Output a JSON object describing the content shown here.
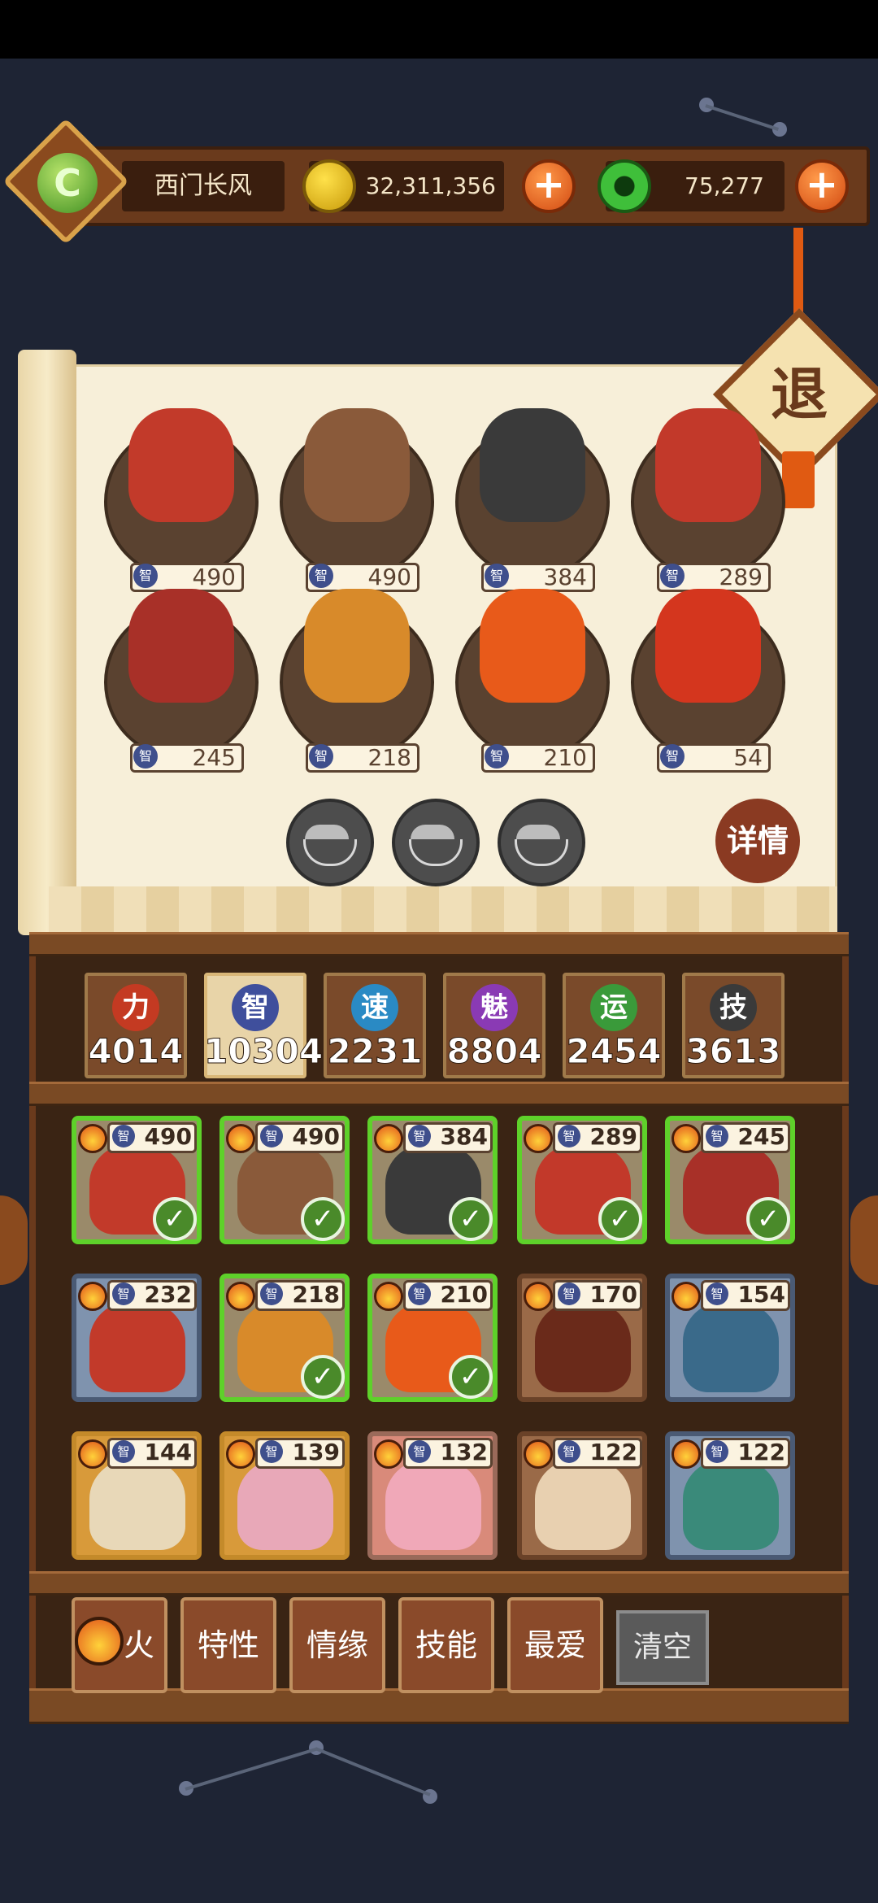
{
  "header": {
    "player_name": "西门长风",
    "logo_icon": "jade-dragon-icon",
    "logo_glyph": "C",
    "coins": "32,311,356",
    "jade": "75,277",
    "plus_label": "+",
    "colors": {
      "coin": "#e8c21a",
      "jade": "#3fbf3a",
      "plus": "#d24a12"
    }
  },
  "exit_label": "退",
  "details_label": "详情",
  "selected_heroes": [
    {
      "stat_icon": "智",
      "value": "490",
      "color": "#c23a2a"
    },
    {
      "stat_icon": "智",
      "value": "490",
      "color": "#8a5a3a"
    },
    {
      "stat_icon": "智",
      "value": "384",
      "color": "#3a3a3a"
    },
    {
      "stat_icon": "智",
      "value": "289",
      "color": "#c2392a"
    },
    {
      "stat_icon": "智",
      "value": "245",
      "color": "#a83028"
    },
    {
      "stat_icon": "智",
      "value": "218",
      "color": "#d88a2a"
    },
    {
      "stat_icon": "智",
      "value": "210",
      "color": "#e85a1a"
    },
    {
      "stat_icon": "智",
      "value": "54",
      "color": "#d4361e"
    }
  ],
  "empty_slots": 3,
  "stat_tabs": [
    {
      "icon": "力",
      "value": "4014",
      "color": "#c43a22",
      "selected": false
    },
    {
      "icon": "智",
      "value": "10304",
      "color": "#3f4f9c",
      "selected": true
    },
    {
      "icon": "速",
      "value": "2231",
      "color": "#2a8ac4",
      "selected": false
    },
    {
      "icon": "魅",
      "value": "8804",
      "color": "#8a3ab4",
      "selected": false
    },
    {
      "icon": "运",
      "value": "2454",
      "color": "#3a9a3a",
      "selected": false
    },
    {
      "icon": "技",
      "value": "3613",
      "color": "#3a3a3a",
      "selected": false
    }
  ],
  "hero_cards": [
    {
      "value": "490",
      "style": "sel",
      "checked": true,
      "art": "#c23a2a"
    },
    {
      "value": "490",
      "style": "sel",
      "checked": true,
      "art": "#8a5a3a"
    },
    {
      "value": "384",
      "style": "sel",
      "checked": true,
      "art": "#3a3a3a"
    },
    {
      "value": "289",
      "style": "sel",
      "checked": true,
      "art": "#c2392a"
    },
    {
      "value": "245",
      "style": "sel",
      "checked": true,
      "art": "#a83028"
    },
    {
      "value": "232",
      "style": "blue",
      "checked": false,
      "art": "#c23a2a"
    },
    {
      "value": "218",
      "style": "sel",
      "checked": true,
      "art": "#d88a2a"
    },
    {
      "value": "210",
      "style": "sel",
      "checked": true,
      "art": "#e85a1a"
    },
    {
      "value": "170",
      "style": "brown",
      "checked": false,
      "art": "#6a2a1a"
    },
    {
      "value": "154",
      "style": "blue",
      "checked": false,
      "art": "#3a6a8a"
    },
    {
      "value": "144",
      "style": "gold",
      "checked": false,
      "art": "#e8d8b8"
    },
    {
      "value": "139",
      "style": "gold",
      "checked": false,
      "art": "#e8a8b8"
    },
    {
      "value": "132",
      "style": "pink",
      "checked": false,
      "art": "#f0a8b8"
    },
    {
      "value": "122",
      "style": "brown",
      "checked": false,
      "art": "#e8d0b0"
    },
    {
      "value": "122",
      "style": "blue",
      "checked": false,
      "art": "#3a8a7a"
    }
  ],
  "card_stat": "智",
  "check_mark": "✓",
  "filters": {
    "fire": "火",
    "trait": "特性",
    "bond": "情缘",
    "skill": "技能",
    "favorite": "最爱",
    "clear": "清空"
  }
}
